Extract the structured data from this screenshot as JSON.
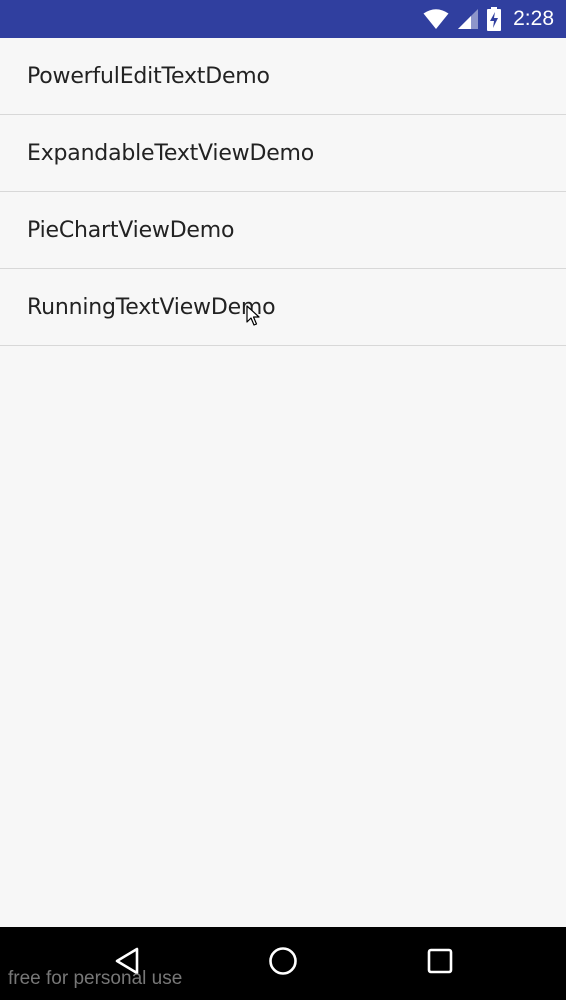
{
  "status_bar": {
    "time": "2:28",
    "icons": [
      "wifi-icon",
      "cell-signal-icon",
      "battery-charging-icon"
    ],
    "background": "#303f9f"
  },
  "list": {
    "items": [
      {
        "label": "PowerfulEditTextDemo"
      },
      {
        "label": "ExpandableTextViewDemo"
      },
      {
        "label": "PieChartViewDemo"
      },
      {
        "label": "RunningTextViewDemo"
      }
    ]
  },
  "nav_bar": {
    "buttons": [
      "back-icon",
      "home-icon",
      "recents-icon"
    ],
    "background": "#000000"
  },
  "watermark": {
    "text": "free for personal use"
  }
}
